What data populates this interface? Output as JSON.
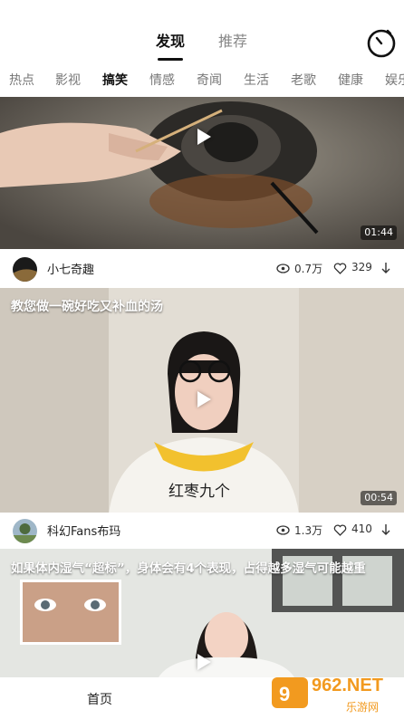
{
  "header": {
    "tab_discover": "发现",
    "tab_recommend": "推荐",
    "timer_icon": "stopwatch-icon"
  },
  "categories": [
    "热点",
    "影视",
    "搞笑",
    "情感",
    "奇闻",
    "生活",
    "老歌",
    "健康",
    "娱乐"
  ],
  "active_category": "搞笑",
  "videos": [
    {
      "title": "",
      "duration": "01:44",
      "author": "小七奇趣",
      "views": "0.7万",
      "likes": "329"
    },
    {
      "title": "教您做一碗好吃又补血的汤",
      "duration": "00:54",
      "subtitle": "红枣九个",
      "author": "科幻Fans布玛",
      "views": "1.3万",
      "likes": "410"
    },
    {
      "title": "如果体内湿气“超标”，身体会有4个表现，占得越多湿气可能越重"
    }
  ],
  "bottom_nav": {
    "home": "首页"
  },
  "watermark": {
    "brand": "962.NET",
    "sub": "乐游网"
  }
}
